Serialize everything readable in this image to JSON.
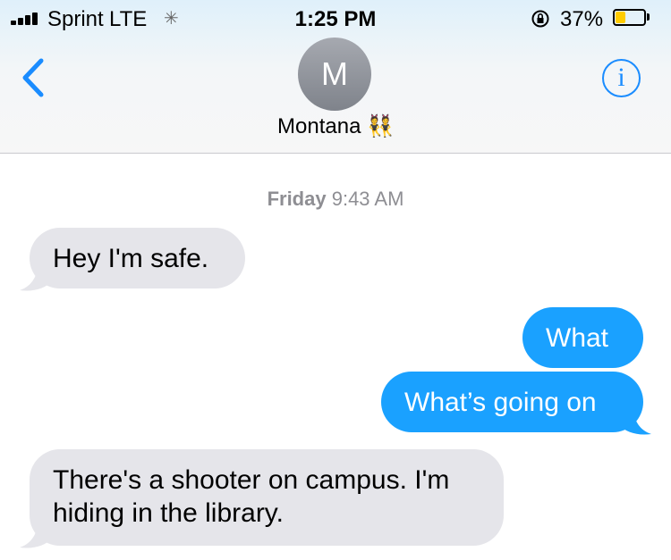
{
  "status_bar": {
    "carrier": "Sprint",
    "network": "LTE",
    "time": "1:25 PM",
    "battery_percent": "37%",
    "battery_level": 0.37,
    "battery_color": "#ffcc00"
  },
  "header": {
    "avatar_initial": "M",
    "contact_name": "Montana",
    "contact_emoji": "👯",
    "back_icon": "chevron-left-icon",
    "info_icon": "info-icon",
    "info_glyph": "i",
    "accent_color": "#1a8cff"
  },
  "conversation": {
    "timestamp_day": "Friday",
    "timestamp_time": "9:43 AM",
    "messages": [
      {
        "direction": "incoming",
        "text": "Hey I'm safe."
      },
      {
        "direction": "outgoing",
        "text": "What"
      },
      {
        "direction": "outgoing",
        "text": "What’s going on"
      },
      {
        "direction": "incoming",
        "text": "There's a shooter on campus. I'm hiding in the library."
      }
    ],
    "incoming_color": "#e5e5ea",
    "outgoing_color": "#1aa1ff"
  }
}
